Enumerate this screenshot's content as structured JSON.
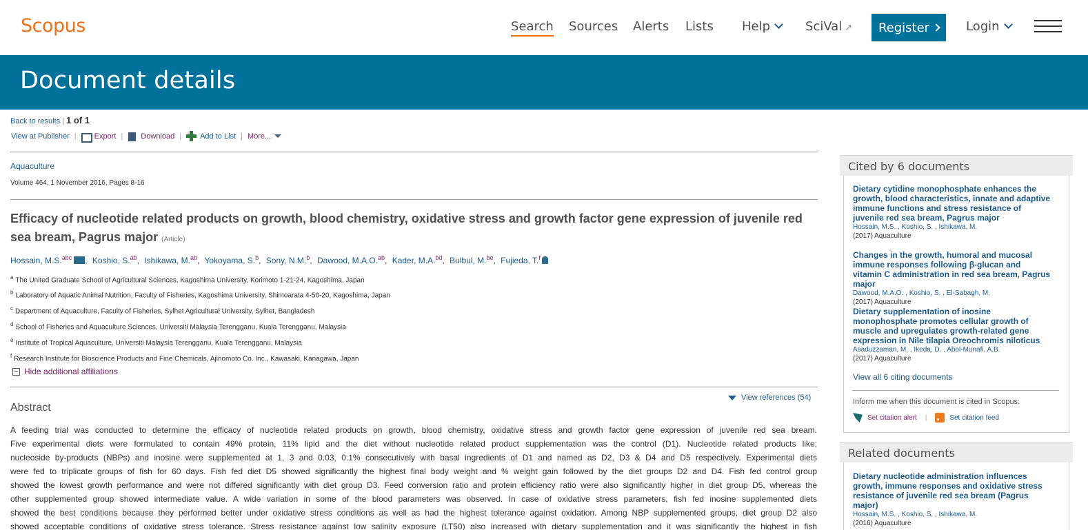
{
  "header": {
    "logo": "Scopus",
    "nav": {
      "search": "Search",
      "sources": "Sources",
      "alerts": "Alerts",
      "lists": "Lists",
      "help": "Help",
      "scival": "SciVal",
      "scival_ext": "↗",
      "register": "Register",
      "login": "Login"
    },
    "accent_color": "#e9711c",
    "brand_color": "#00729b"
  },
  "banner": {
    "title": "Document details"
  },
  "toolbar": {
    "back_to_results": "Back to results",
    "sep": "|",
    "count": "1 of 1",
    "view_at_publisher": "View at Publisher",
    "export": "Export",
    "download": "Download",
    "add_to_list": "Add to List",
    "more": "More...",
    "pipe": "|"
  },
  "doc": {
    "journal": "Aquaculture",
    "volume": "Volume 464, 1 November 2016, Pages 8-16",
    "title": "Efficacy of nucleotide related products on growth, blood chemistry, oxidative stress and growth factor gene expression of juvenile red sea bream, Pagrus major",
    "article_type": "(Article)",
    "authors": [
      {
        "name": "Hossain, M.S.",
        "sup": "abc"
      },
      {
        "name": "Koshio, S.",
        "sup": "ab"
      },
      {
        "name": "Ishikawa, M.",
        "sup": "ab"
      },
      {
        "name": "Yokoyama, S.",
        "sup": "b"
      },
      {
        "name": "Sony, N.M.",
        "sup": "b"
      },
      {
        "name": "Dawood, M.A.O.",
        "sup": "ab"
      },
      {
        "name": "Kader, M.A.",
        "sup": "bd"
      },
      {
        "name": "Bulbul, M.",
        "sup": "be"
      },
      {
        "name": "Fujieda, T.",
        "sup": "f"
      }
    ],
    "comma": ",",
    "affiliations": [
      {
        "key": "a",
        "text": "The United Graduate School of Agricultural Sciences, Kagoshima University, Korimoto 1-21-24, Kagoshima, Japan"
      },
      {
        "key": "b",
        "text": "Laboratory of Aquatic Animal Nutrition, Faculty of Fisheries, Kagoshima University, Shimoarata 4-50-20, Kagoshima, Japan"
      },
      {
        "key": "c",
        "text": "Department of Aquaculture, Faculty of Fisheries, Sylhet Agricultural University, Sylhet, Bangladesh"
      },
      {
        "key": "d",
        "text": "School of Fisheries and Aquaculture Sciences, Universiti Malaysia Terengganu, Kuala Terengganu, Malaysia"
      },
      {
        "key": "e",
        "text": "Institute of Tropical Aquaculture, Universiti Malaysia Terengganu, Kuala Terengganu, Malaysia"
      },
      {
        "key": "f",
        "text": "Research Institute for Bioscience Products and Fine Chemicals, Ajinomoto Co. Inc., Kawasaki, Kanagawa, Japan"
      }
    ],
    "hide_affiliations": "Hide additional affiliations",
    "abstract_heading": "Abstract",
    "view_references": "View references (54)",
    "abstract_lines": [
      "A feeding trial was conducted to determine the efficacy of nucleotide related products on growth, blood chemistry, oxidative stress and growth factor gene expression of juvenile red sea bream.",
      "Five experimental diets were formulated to contain 49% protein, 11% lipid and the diet without nucleotide related product supplementation was the control (D1). Nucleotide related products like;",
      "nucleoside by-products (NBPs) and inosine were supplemented at 1, 3 and 0.03, 0.1% consecutively with basal ingredients of D1 and named as D2, D3 & D4 and D5 respectively. Experimental diets",
      "were fed to triplicate groups of fish for 60 days. Fish fed diet D5 showed significantly the highest final body weight and % weight gain followed by the diet groups D2 and D4. Fish fed control group",
      "showed the lowest growth performance and were not differed significantly with diet group D3. Feed conversion ratio and protein efficiency ratio were also significantly higher in diet group D5, whereas the",
      "other supplemented group showed intermediate value. A wide variation in some of the blood parameters was observed. In case of oxidative stress parameters, fish fed inosine supplemented diets",
      "showed the best conditions because they performed better under oxidative stress conditions as well as had the highest tolerance against oxidation. Among NBP supplemented groups, diet group D2 also",
      "showed acceptable conditions of oxidative stress tolerance. Stress resistance against low salinity exposure (LT50) also increased with dietary supplementation and it was significantly the highest in fish"
    ]
  },
  "cited_by": {
    "heading": "Cited by 6 documents",
    "items": [
      {
        "title": "Dietary cytidine monophosphate enhances the growth, blood characteristics, innate and adaptive immune functions and stress resistance of juvenile red sea bream, Pagrus major",
        "authors": [
          "Hossain, M.S.",
          "Koshio, S.",
          "Ishikawa, M."
        ],
        "year": "(2017)",
        "journal": "Aquaculture"
      },
      {
        "title": "Changes in the growth, humoral and mucosal immune responses following β-glucan and vitamin C administration in red sea bream, Pagrus major",
        "authors": [
          "Dawood, M.A.O.",
          "Koshio, S.",
          "El-Sabagh, M."
        ],
        "year": "(2017)",
        "journal": "Aquaculture"
      },
      {
        "title": "Dietary supplementation of inosine monophosphate promotes cellular growth of muscle and upregulates growth-related gene expression in Nile tilapia Oreochromis niloticus",
        "authors": [
          "Asaduzzaman, M.",
          "Ikeda, D.",
          "Abol-Munafi, A.B."
        ],
        "year": "(2017)",
        "journal": "Aquaculture"
      }
    ],
    "view_all": "View all 6 citing documents",
    "inform": "Inform me when this document is cited in Scopus:",
    "set_alert": "Set citation alert",
    "set_feed": "Set citation feed",
    "pipe": "|"
  },
  "related": {
    "heading": "Related documents",
    "items": [
      {
        "title": "Dietary nucleotide administration influences growth, immune responses and oxidative stress resistance of juvenile red sea bream (Pagrus major)",
        "authors": [
          "Hossain, M.S.",
          "Koshio, S.",
          "Ishikawa, M."
        ],
        "year": "(2016)",
        "journal": "Aquaculture"
      }
    ]
  }
}
